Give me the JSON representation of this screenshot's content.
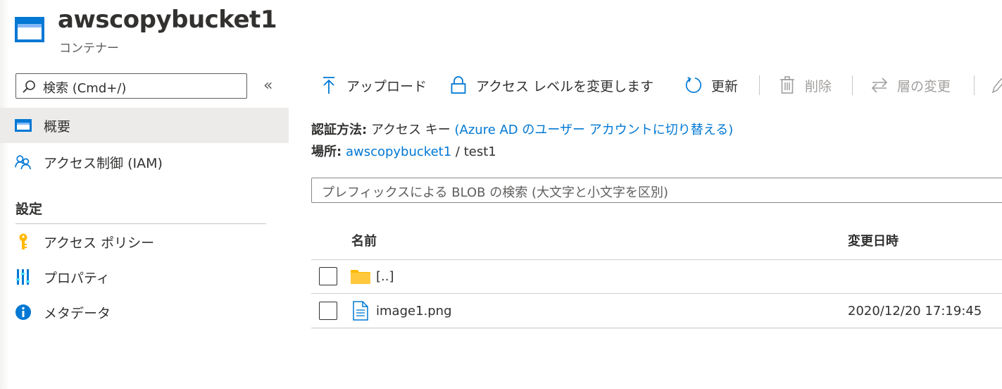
{
  "header": {
    "title": "awscopybucket1",
    "subtitle": "コンテナー",
    "icon": "container-icon"
  },
  "sidebar": {
    "search_placeholder": "検索 (Cmd+/)",
    "collapse_glyph": "«",
    "items": [
      {
        "label": "概要",
        "icon": "overview-icon",
        "selected": true
      },
      {
        "label": "アクセス制御 (IAM)",
        "icon": "people-icon"
      }
    ],
    "settings_heading": "設定",
    "settings_items": [
      {
        "label": "アクセス ポリシー",
        "icon": "key-icon"
      },
      {
        "label": "プロパティ",
        "icon": "properties-icon"
      },
      {
        "label": "メタデータ",
        "icon": "info-icon"
      }
    ]
  },
  "toolbar": {
    "upload": "アップロード",
    "access_level": "アクセス レベルを変更します",
    "refresh": "更新",
    "delete": "削除",
    "change_tier": "層の変更"
  },
  "auth": {
    "label": "認証方法:",
    "value": "アクセス キー",
    "switch_link": "(Azure AD のユーザー アカウントに切り替える)"
  },
  "location": {
    "label": "場所:",
    "container_link": "awscopybucket1",
    "separator": "/",
    "folder": "test1"
  },
  "blob_search": {
    "placeholder": "プレフィックスによる BLOB の検索 (大文字と小文字を区別)"
  },
  "table": {
    "columns": [
      "名前",
      "変更日時"
    ],
    "rows": [
      {
        "name": "[..]",
        "type": "folder",
        "modified": ""
      },
      {
        "name": "image1.png",
        "type": "file",
        "modified": "2020/12/20 17:19:45"
      }
    ]
  },
  "colors": {
    "accent": "#0078d4",
    "selected_bg": "#edebe9",
    "folder": "#ffb900",
    "key": "#ffb900"
  }
}
